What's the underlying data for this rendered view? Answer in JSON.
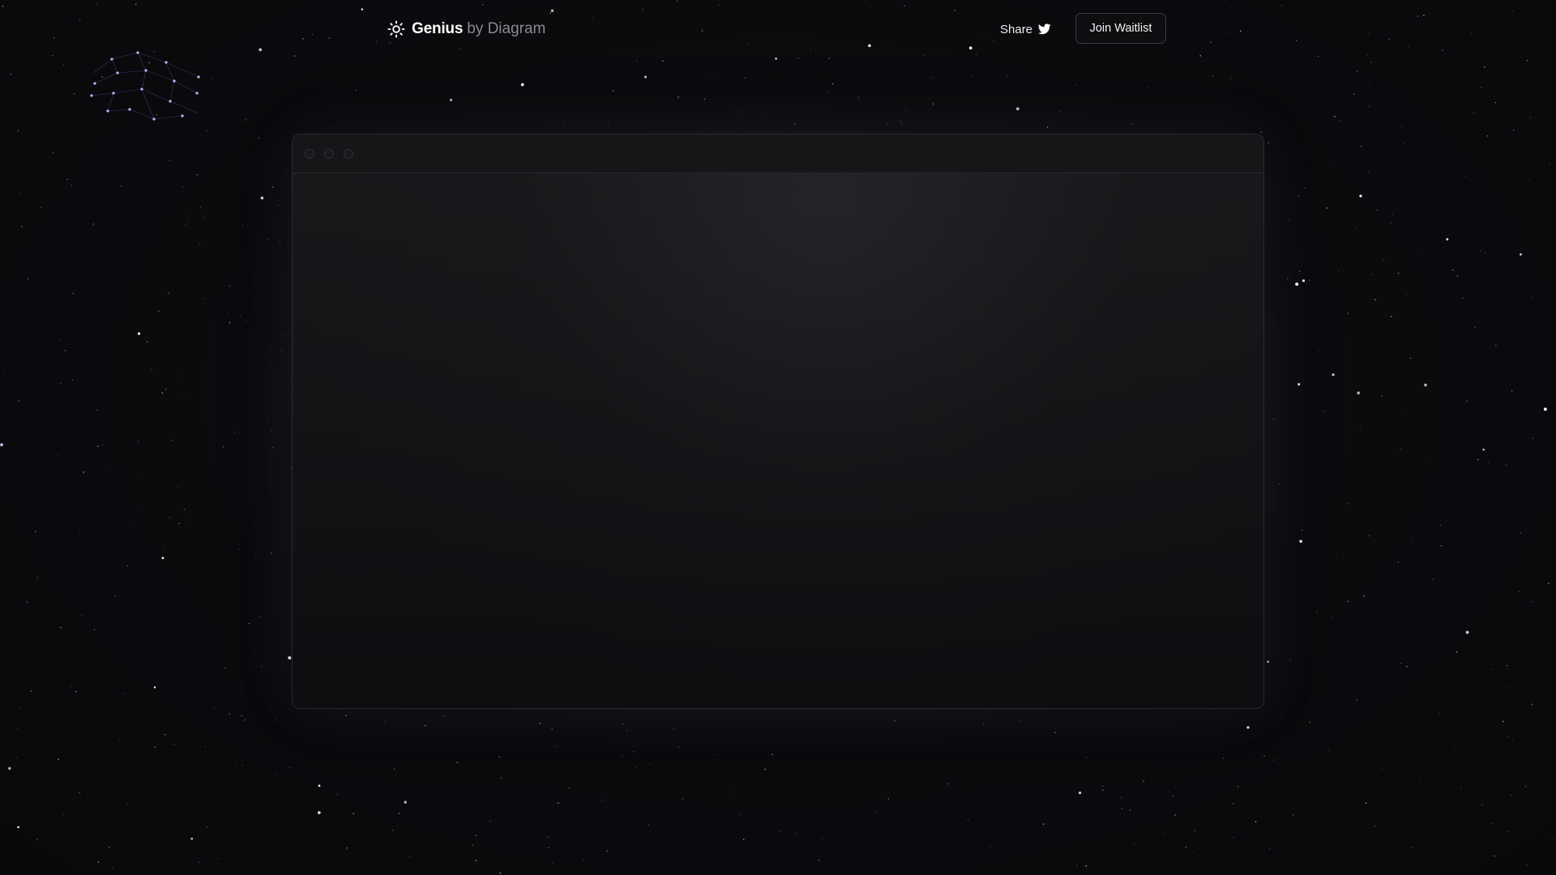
{
  "header": {
    "brand_name": "Genius",
    "brand_by": "by Diagram",
    "brand_icon": "sun-icon",
    "share_label": "Share",
    "share_icon": "twitter-icon",
    "waitlist_label": "Join Waitlist"
  },
  "mockup_window": {
    "traffic_lights": [
      "close",
      "minimize",
      "maximize"
    ]
  },
  "colors": {
    "background": "#0b0b0e",
    "text_primary": "#ffffff",
    "text_muted": "#8a8a90",
    "star": "#ffffff",
    "constellation": "#8f93ff"
  }
}
